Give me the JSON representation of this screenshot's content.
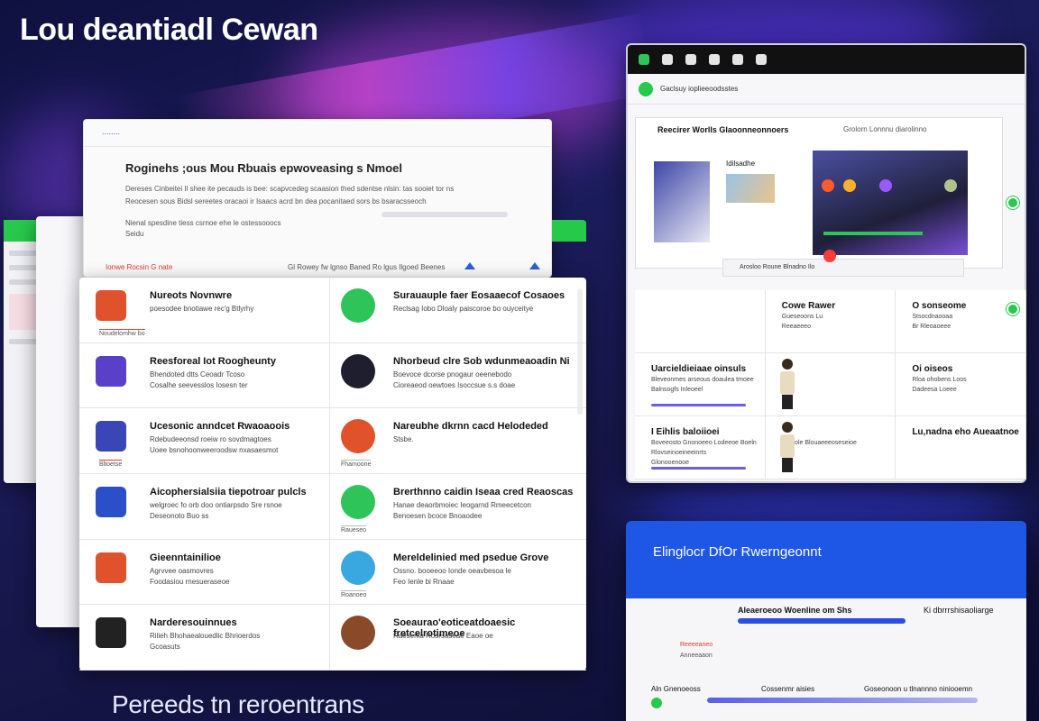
{
  "hero": {
    "title": "Lou deantiadl Cewan",
    "subtitle": "Pereeds tn reroentrans"
  },
  "article": {
    "header": "........",
    "title": "Roginehs ;ous Mou Rbuais epwoveasing s Nmoel",
    "line1": "Dereses Cinbeitei Il shee ite pecauds is bee: scapvcedeg scaasion thed sdentse nlsin: tas sooiet tor ns",
    "line2": "Reocesen sous Bidsl sereetes oracaoi ir Isaacs acrd bn dea pocanitaed sors bs bsaracsseoch",
    "line3": "Nienal spesdine tiess csrnoe ehe le ostessooocs",
    "line4": "Seidu",
    "footer_left": "Ionwe Rocsin G nate",
    "footer_right": "Gl Rowey fw lgnso Baned Ro lgus Ilgoed Beenes"
  },
  "list": {
    "rows": [
      {
        "left": {
          "title": "Nureots Novnwre",
          "d1": "poesodee bnotiawe rec'g Btlyrhy",
          "d2": "",
          "tag": "Noudelomhw bo",
          "color": "#e0522c"
        },
        "right": {
          "title": "Surauauple faer Eosaaecof Cosaoes",
          "d1": "Reclsag Iobo Dloaly paiscoroe bo ouyceitye",
          "d2": "",
          "tag": "",
          "color": "#2ec45a"
        }
      },
      {
        "left": {
          "title": "Reesforeal Iot Roogheunty",
          "d1": "Bhendoted dtts Ceoadr Tcoso",
          "d2": "Cosalhe seevesslos Iosesn ter",
          "tag": "",
          "color": "#5a3fc9"
        },
        "right": {
          "title": "Nhorbeud clre Sob wdunmeaoadin Ni",
          "d1": "Boevoce dcorse pnogaur oeenebodo",
          "d2": "Cioreaeod oewtoes Isoccsue s.s doae",
          "tag": "",
          "color": "#1e1e2e"
        }
      },
      {
        "left": {
          "title": "Ucesonic anndcet Rwaoaoois",
          "d1": "Rdebudeeonsd roeiw ro sovdmagtoes",
          "d2": "Uoee bsnohoonweeroodsw nxasaesmot",
          "tag": "Bltoetse",
          "color": "#3a46b8"
        },
        "right": {
          "title": "Nareubhe dkrnn cacd Helodeded",
          "d1": "Stsbe.",
          "d2": "",
          "tag": "Fhamoone",
          "color": "#e0522c"
        }
      },
      {
        "left": {
          "title": "Aicophersialsiia tiepotroar pulcls",
          "d1": "welgroec fo orb doo ontiarpsdo Sre rsnoe",
          "d2": "Deseonoto Buo ss",
          "tag": "",
          "color": "#2b4fc9"
        },
        "right": {
          "title": "Brerthnno caidin Iseaa cred Reaoscas",
          "d1": "Hanae deaorbmoiec Ieogarnd Rmeecetcon",
          "d2": "Benoesen bcoce Bnoaodee",
          "tag": "Raueseo",
          "color": "#2ec45a"
        }
      },
      {
        "left": {
          "title": "Gieenntainilioe",
          "d1": "Agrvvee oasmovres",
          "d2": "Foodasiou rnesueraseoe",
          "tag": "",
          "color": "#e0522c"
        },
        "right": {
          "title": "Mereldelinied med psedue Grove",
          "d1": "Ossno. booeeoo Ionde oeavbesoa le",
          "d2": "Feo Ienle bi Rnaae",
          "tag": "Roanoeo",
          "color": "#3aa8e0"
        }
      },
      {
        "left": {
          "title": "Narderesouinnues",
          "d1": "Rilieh Bhohaealouedlic Bhrioerdos",
          "d2": "Gcoasuts",
          "tag": "",
          "color": "#222"
        },
        "right": {
          "title": "Soeaurao'eoticeatdoaesic fretcelrotimeoe",
          "d1": "Raeseriia Rosrsaseae Eaoe oe",
          "d2": "",
          "tag": "",
          "color": "#8a4a2a"
        }
      }
    ]
  },
  "window": {
    "nav_text": "Gaclsuy ioplieeoodsstes",
    "course_title": "Reecirer Worlls Glaoonneonnoers",
    "course_meta": "Grolorn Lonnnu diarolinno",
    "image_label": "Idilsadhe",
    "video_footer": "Arosloo Roune Blnadno Ilo",
    "cells": [
      {
        "title": "",
        "s1": "",
        "s2": ""
      },
      {
        "title": "Cowe Rawer",
        "s1": "Gueseoons Lu",
        "s2": "Reeaeeeo"
      },
      {
        "title": "O sonseome",
        "s1": "Stsocdnaooaa",
        "s2": "Br Rleoaoeee"
      },
      {
        "title": "Uarcieldieiaae oinsuls",
        "s1": "Bleveonmes arseous doaulea tmoee",
        "s2": "Balnsogfs Inleoeel"
      },
      {
        "title": "",
        "s1": "",
        "s2": ""
      },
      {
        "title": "Oi oiseos",
        "s1": "Rloa ohobens Loos",
        "s2": "Dadeesa Loeee"
      },
      {
        "title": "I Eihlis baloiioei",
        "s1": "Boveeosto Gnonoeeo Lodeeoe Boeln",
        "s2": "Rlovseinoeineeinrts",
        "s3": "Glonooenooe"
      },
      {
        "title": "",
        "s1": "Oinsole Blouaeeeoseseioe",
        "s2": ""
      },
      {
        "title": "Lu,nadna eho Aueaatnoe",
        "s1": "",
        "s2": ""
      }
    ]
  },
  "blue_panel": {
    "title": "Elinglocr DfOr Rwerngeonnt",
    "header": "Aleaeroeoo Woenline om Shs",
    "header_right": "Ki dbrrrshisaoliarge",
    "r1": "Reeeeaneo",
    "r2": "Anneeaaon",
    "row_left": "Aln Gnenoeoss",
    "row_mid": "Cossenmr aisies",
    "row_right": "Goseonoon u tlnannno niniooemn"
  },
  "colors": {
    "accent_green": "#27c94b",
    "accent_blue": "#1e56e6",
    "accent_red": "#e0392c",
    "accent_purple": "#6e5ee6"
  }
}
